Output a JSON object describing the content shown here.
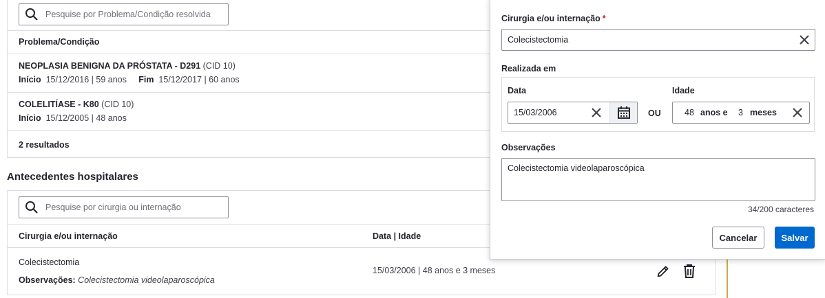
{
  "problems": {
    "search_placeholder": "Pesquise por Problema/Condição resolvida",
    "column_header": "Problema/Condição",
    "rows": [
      {
        "name": "NEOPLASIA BENIGNA DA PRÓSTATA - D291",
        "cid": "(CID 10)",
        "start_label": "Início",
        "start_value": "15/12/2016 | 59 anos",
        "end_label": "Fim",
        "end_value": "15/12/2017 | 60 anos"
      },
      {
        "name": "COLELITÍASE - K80",
        "cid": "(CID 10)",
        "start_label": "Início",
        "start_value": "15/12/2005 | 48 anos"
      }
    ],
    "results_count": "2 resultados"
  },
  "hospital": {
    "section_title": "Antecedentes hospitalares",
    "search_placeholder": "Pesquise por cirurgia ou internação",
    "columns": {
      "procedure": "Cirurgia e/ou internação",
      "date_age": "Data | Idade"
    },
    "row": {
      "name": "Colecistectomia",
      "obs_label": "Observações:",
      "obs_value": "Colecistectomia videolaparoscópica",
      "date_age": "15/03/2006 | 48 anos e 3 meses"
    },
    "icons": {
      "edit": "pencil-icon",
      "delete": "trash-icon"
    }
  },
  "form": {
    "procedure_label": "Cirurgia e/ou internação",
    "required_mark": "*",
    "procedure_value": "Colecistectomia",
    "performed_label": "Realizada em",
    "date_label": "Data",
    "date_value": "15/03/2006",
    "or_label": "OU",
    "age_label": "Idade",
    "age_years": "48",
    "age_years_unit": "anos e",
    "age_months": "3",
    "age_months_unit": "meses",
    "observations_label": "Observações",
    "observations_value": "Colecistectomia videolaparoscópica",
    "char_counter": "34/200 caracteres",
    "cancel_label": "Cancelar",
    "save_label": "Salvar"
  },
  "colors": {
    "primary": "#0069d0",
    "required": "#d01f2b",
    "border": "#dcdde4",
    "accent_line": "#c9a94a"
  }
}
